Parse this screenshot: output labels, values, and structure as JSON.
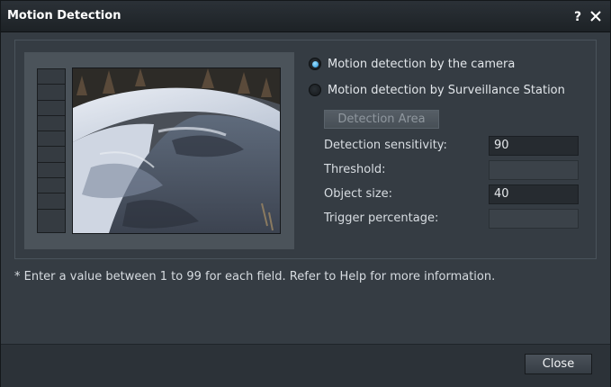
{
  "dialog": {
    "title": "Motion Detection",
    "help_icon": "help-icon",
    "close_icon": "close-icon"
  },
  "detection_source": {
    "options": [
      {
        "label": "Motion detection by the camera",
        "selected": true
      },
      {
        "label": "Motion detection by Surveillance Station",
        "selected": false
      }
    ]
  },
  "detection_area_button": {
    "label": "Detection Area",
    "enabled": false
  },
  "fields": {
    "sensitivity": {
      "label": "Detection sensitivity:",
      "value": "90",
      "enabled": true
    },
    "threshold": {
      "label": "Threshold:",
      "value": "",
      "enabled": false
    },
    "object_size": {
      "label": "Object size:",
      "value": "40",
      "enabled": true
    },
    "trigger_percentage": {
      "label": "Trigger percentage:",
      "value": "",
      "enabled": false
    }
  },
  "hint": "* Enter a value between 1 to 99 for each field. Refer to Help for more information.",
  "footer": {
    "close_label": "Close"
  },
  "colors": {
    "accent": "#1e8fd6",
    "dialog_bg": "#353c43",
    "titlebar_bg": "#1d2226"
  }
}
